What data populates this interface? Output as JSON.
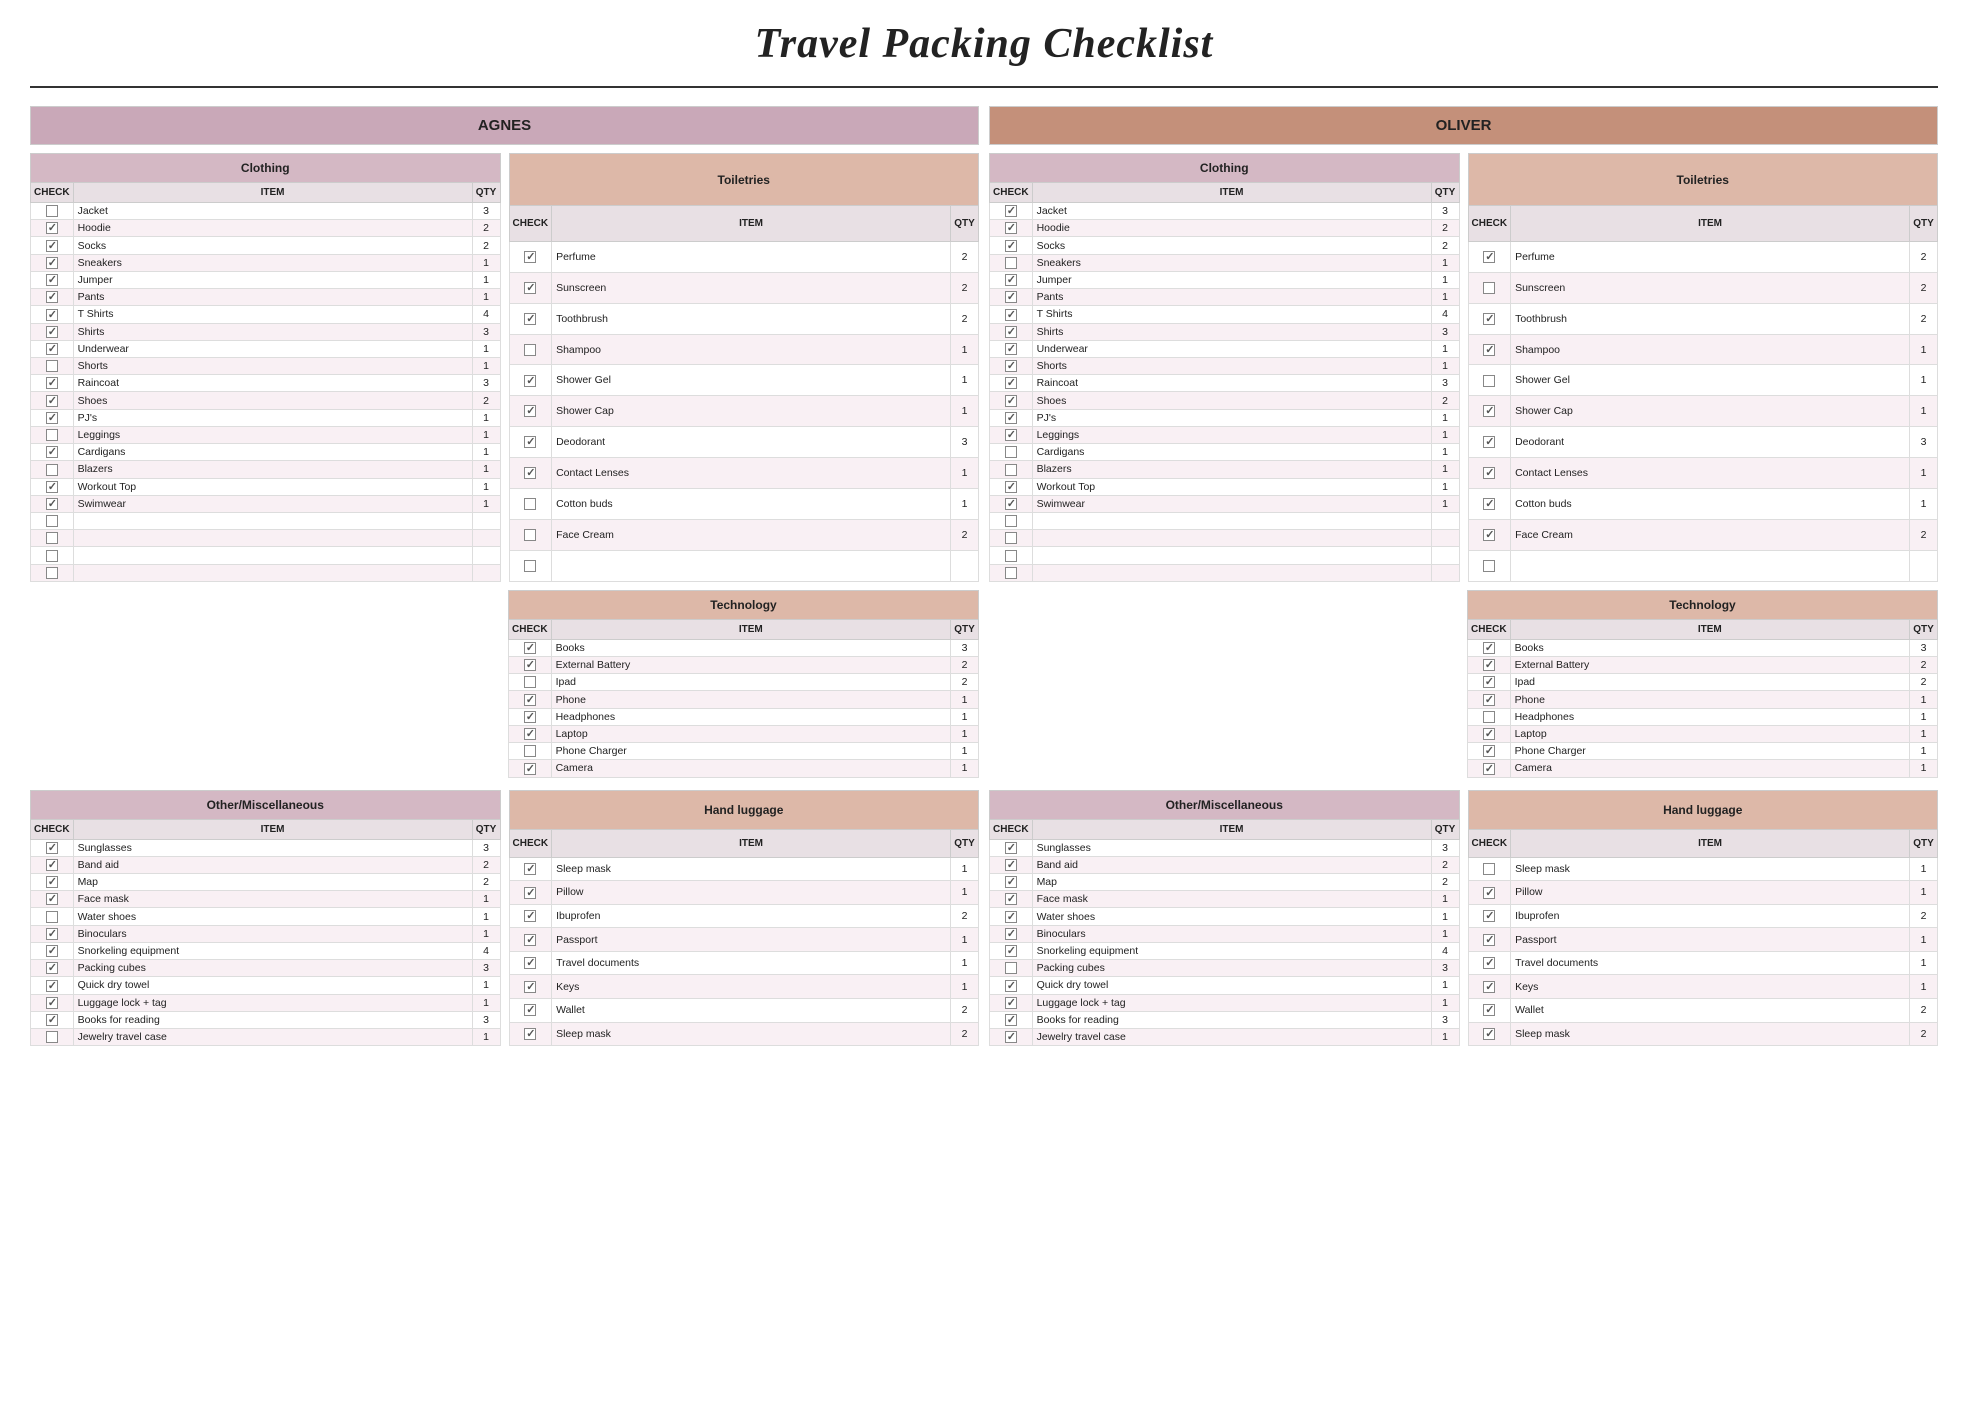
{
  "title": "Travel Packing Checklist",
  "persons": [
    {
      "name": "AGNES",
      "class": "agnes",
      "clothing": {
        "headers": [
          "CHECK",
          "ITEM",
          "QTY"
        ],
        "rows": [
          {
            "checked": false,
            "item": "Jacket",
            "qty": 3
          },
          {
            "checked": true,
            "item": "Hoodie",
            "qty": 2
          },
          {
            "checked": true,
            "item": "Socks",
            "qty": 2
          },
          {
            "checked": true,
            "item": "Sneakers",
            "qty": 1
          },
          {
            "checked": true,
            "item": "Jumper",
            "qty": 1
          },
          {
            "checked": true,
            "item": "Pants",
            "qty": 1
          },
          {
            "checked": true,
            "item": "T Shirts",
            "qty": 4
          },
          {
            "checked": true,
            "item": "Shirts",
            "qty": 3
          },
          {
            "checked": true,
            "item": "Underwear",
            "qty": 1
          },
          {
            "checked": false,
            "item": "Shorts",
            "qty": 1
          },
          {
            "checked": true,
            "item": "Raincoat",
            "qty": 3
          },
          {
            "checked": true,
            "item": "Shoes",
            "qty": 2
          },
          {
            "checked": true,
            "item": "PJ's",
            "qty": 1
          },
          {
            "checked": false,
            "item": "Leggings",
            "qty": 1
          },
          {
            "checked": true,
            "item": "Cardigans",
            "qty": 1
          },
          {
            "checked": false,
            "item": "Blazers",
            "qty": 1
          },
          {
            "checked": true,
            "item": "Workout Top",
            "qty": 1
          },
          {
            "checked": true,
            "item": "Swimwear",
            "qty": 1
          },
          {
            "checked": false,
            "item": "",
            "qty": ""
          },
          {
            "checked": false,
            "item": "",
            "qty": ""
          },
          {
            "checked": false,
            "item": "",
            "qty": ""
          },
          {
            "checked": false,
            "item": "",
            "qty": ""
          }
        ]
      },
      "toiletries": {
        "headers": [
          "CHECK",
          "ITEM",
          "QTY"
        ],
        "rows": [
          {
            "checked": true,
            "item": "Perfume",
            "qty": 2
          },
          {
            "checked": true,
            "item": "Sunscreen",
            "qty": 2
          },
          {
            "checked": true,
            "item": "Toothbrush",
            "qty": 2
          },
          {
            "checked": false,
            "item": "Shampoo",
            "qty": 1
          },
          {
            "checked": true,
            "item": "Shower Gel",
            "qty": 1
          },
          {
            "checked": true,
            "item": "Shower Cap",
            "qty": 1
          },
          {
            "checked": true,
            "item": "Deodorant",
            "qty": 3
          },
          {
            "checked": true,
            "item": "Contact Lenses",
            "qty": 1
          },
          {
            "checked": false,
            "item": "Cotton buds",
            "qty": 1
          },
          {
            "checked": false,
            "item": "Face Cream",
            "qty": 2
          },
          {
            "checked": false,
            "item": "",
            "qty": ""
          }
        ]
      },
      "technology": {
        "headers": [
          "CHECK",
          "ITEM",
          "QTY"
        ],
        "rows": [
          {
            "checked": true,
            "item": "Books",
            "qty": 3
          },
          {
            "checked": true,
            "item": "External Battery",
            "qty": 2
          },
          {
            "checked": false,
            "item": "Ipad",
            "qty": 2
          },
          {
            "checked": true,
            "item": "Phone",
            "qty": 1
          },
          {
            "checked": true,
            "item": "Headphones",
            "qty": 1
          },
          {
            "checked": true,
            "item": "Laptop",
            "qty": 1
          },
          {
            "checked": false,
            "item": "Phone Charger",
            "qty": 1
          },
          {
            "checked": true,
            "item": "Camera",
            "qty": 1
          }
        ]
      },
      "other": {
        "headers": [
          "CHECK",
          "ITEM",
          "QTY"
        ],
        "rows": [
          {
            "checked": true,
            "item": "Sunglasses",
            "qty": 3
          },
          {
            "checked": true,
            "item": "Band aid",
            "qty": 2
          },
          {
            "checked": true,
            "item": "Map",
            "qty": 2
          },
          {
            "checked": true,
            "item": "Face mask",
            "qty": 1
          },
          {
            "checked": false,
            "item": "Water shoes",
            "qty": 1
          },
          {
            "checked": true,
            "item": "Binoculars",
            "qty": 1
          },
          {
            "checked": true,
            "item": "Snorkeling equipment",
            "qty": 4
          },
          {
            "checked": true,
            "item": "Packing cubes",
            "qty": 3
          },
          {
            "checked": true,
            "item": "Quick dry towel",
            "qty": 1
          },
          {
            "checked": true,
            "item": "Luggage lock + tag",
            "qty": 1
          },
          {
            "checked": true,
            "item": "Books for reading",
            "qty": 3
          },
          {
            "checked": false,
            "item": "Jewelry travel case",
            "qty": 1
          }
        ]
      },
      "handluggage": {
        "headers": [
          "CHECK",
          "ITEM",
          "QTY"
        ],
        "rows": [
          {
            "checked": true,
            "item": "Sleep mask",
            "qty": 1
          },
          {
            "checked": true,
            "item": "Pillow",
            "qty": 1
          },
          {
            "checked": true,
            "item": "Ibuprofen",
            "qty": 2
          },
          {
            "checked": true,
            "item": "Passport",
            "qty": 1
          },
          {
            "checked": true,
            "item": "Travel documents",
            "qty": 1
          },
          {
            "checked": true,
            "item": "Keys",
            "qty": 1
          },
          {
            "checked": true,
            "item": "Wallet",
            "qty": 2
          },
          {
            "checked": true,
            "item": "Sleep mask",
            "qty": 2
          }
        ]
      }
    },
    {
      "name": "OLIVER",
      "class": "oliver",
      "clothing": {
        "headers": [
          "CHECK",
          "ITEM",
          "QTY"
        ],
        "rows": [
          {
            "checked": true,
            "item": "Jacket",
            "qty": 3
          },
          {
            "checked": true,
            "item": "Hoodie",
            "qty": 2
          },
          {
            "checked": true,
            "item": "Socks",
            "qty": 2
          },
          {
            "checked": false,
            "item": "Sneakers",
            "qty": 1
          },
          {
            "checked": true,
            "item": "Jumper",
            "qty": 1
          },
          {
            "checked": true,
            "item": "Pants",
            "qty": 1
          },
          {
            "checked": true,
            "item": "T Shirts",
            "qty": 4
          },
          {
            "checked": true,
            "item": "Shirts",
            "qty": 3
          },
          {
            "checked": true,
            "item": "Underwear",
            "qty": 1
          },
          {
            "checked": true,
            "item": "Shorts",
            "qty": 1
          },
          {
            "checked": true,
            "item": "Raincoat",
            "qty": 3
          },
          {
            "checked": true,
            "item": "Shoes",
            "qty": 2
          },
          {
            "checked": true,
            "item": "PJ's",
            "qty": 1
          },
          {
            "checked": true,
            "item": "Leggings",
            "qty": 1
          },
          {
            "checked": false,
            "item": "Cardigans",
            "qty": 1
          },
          {
            "checked": false,
            "item": "Blazers",
            "qty": 1
          },
          {
            "checked": true,
            "item": "Workout Top",
            "qty": 1
          },
          {
            "checked": true,
            "item": "Swimwear",
            "qty": 1
          },
          {
            "checked": false,
            "item": "",
            "qty": ""
          },
          {
            "checked": false,
            "item": "",
            "qty": ""
          },
          {
            "checked": false,
            "item": "",
            "qty": ""
          },
          {
            "checked": false,
            "item": "",
            "qty": ""
          }
        ]
      },
      "toiletries": {
        "headers": [
          "CHECK",
          "ITEM",
          "QTY"
        ],
        "rows": [
          {
            "checked": true,
            "item": "Perfume",
            "qty": 2
          },
          {
            "checked": false,
            "item": "Sunscreen",
            "qty": 2
          },
          {
            "checked": true,
            "item": "Toothbrush",
            "qty": 2
          },
          {
            "checked": true,
            "item": "Shampoo",
            "qty": 1
          },
          {
            "checked": false,
            "item": "Shower Gel",
            "qty": 1
          },
          {
            "checked": true,
            "item": "Shower Cap",
            "qty": 1
          },
          {
            "checked": true,
            "item": "Deodorant",
            "qty": 3
          },
          {
            "checked": true,
            "item": "Contact Lenses",
            "qty": 1
          },
          {
            "checked": true,
            "item": "Cotton buds",
            "qty": 1
          },
          {
            "checked": true,
            "item": "Face Cream",
            "qty": 2
          },
          {
            "checked": false,
            "item": "",
            "qty": ""
          }
        ]
      },
      "technology": {
        "headers": [
          "CHECK",
          "ITEM",
          "QTY"
        ],
        "rows": [
          {
            "checked": true,
            "item": "Books",
            "qty": 3
          },
          {
            "checked": true,
            "item": "External Battery",
            "qty": 2
          },
          {
            "checked": true,
            "item": "Ipad",
            "qty": 2
          },
          {
            "checked": true,
            "item": "Phone",
            "qty": 1
          },
          {
            "checked": false,
            "item": "Headphones",
            "qty": 1
          },
          {
            "checked": true,
            "item": "Laptop",
            "qty": 1
          },
          {
            "checked": true,
            "item": "Phone Charger",
            "qty": 1
          },
          {
            "checked": true,
            "item": "Camera",
            "qty": 1
          }
        ]
      },
      "other": {
        "headers": [
          "CHECK",
          "ITEM",
          "QTY"
        ],
        "rows": [
          {
            "checked": true,
            "item": "Sunglasses",
            "qty": 3
          },
          {
            "checked": true,
            "item": "Band aid",
            "qty": 2
          },
          {
            "checked": true,
            "item": "Map",
            "qty": 2
          },
          {
            "checked": true,
            "item": "Face mask",
            "qty": 1
          },
          {
            "checked": true,
            "item": "Water shoes",
            "qty": 1
          },
          {
            "checked": true,
            "item": "Binoculars",
            "qty": 1
          },
          {
            "checked": true,
            "item": "Snorkeling equipment",
            "qty": 4
          },
          {
            "checked": false,
            "item": "Packing cubes",
            "qty": 3
          },
          {
            "checked": true,
            "item": "Quick dry towel",
            "qty": 1
          },
          {
            "checked": true,
            "item": "Luggage lock + tag",
            "qty": 1
          },
          {
            "checked": true,
            "item": "Books for reading",
            "qty": 3
          },
          {
            "checked": true,
            "item": "Jewelry travel case",
            "qty": 1
          }
        ]
      },
      "handluggage": {
        "headers": [
          "CHECK",
          "ITEM",
          "QTY"
        ],
        "rows": [
          {
            "checked": false,
            "item": "Sleep mask",
            "qty": 1
          },
          {
            "checked": true,
            "item": "Pillow",
            "qty": 1
          },
          {
            "checked": true,
            "item": "Ibuprofen",
            "qty": 2
          },
          {
            "checked": true,
            "item": "Passport",
            "qty": 1
          },
          {
            "checked": true,
            "item": "Travel documents",
            "qty": 1
          },
          {
            "checked": true,
            "item": "Keys",
            "qty": 1
          },
          {
            "checked": true,
            "item": "Wallet",
            "qty": 2
          },
          {
            "checked": true,
            "item": "Sleep mask",
            "qty": 2
          }
        ]
      }
    }
  ],
  "section_labels": {
    "clothing": "Clothing",
    "toiletries": "Toiletries",
    "technology": "Technology",
    "other": "Other/Miscellaneous",
    "handluggage": "Hand luggage"
  }
}
